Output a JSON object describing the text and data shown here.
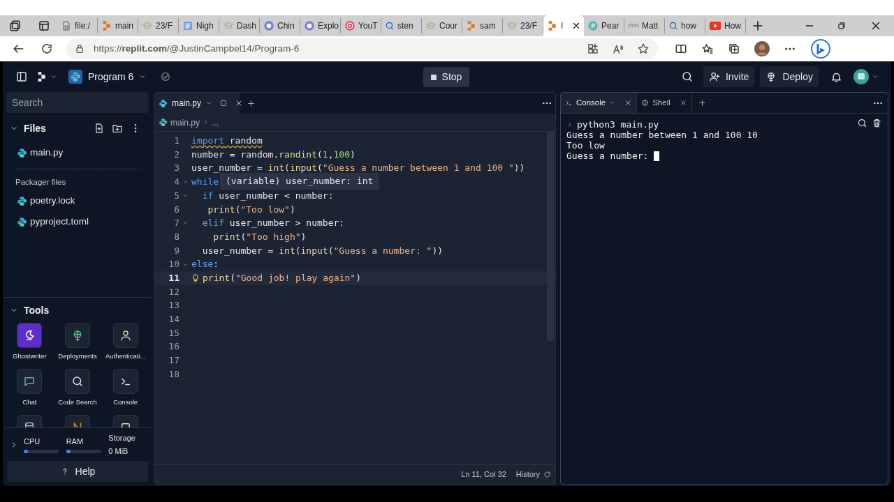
{
  "browser": {
    "tabs": [
      {
        "title": "file:/",
        "kind": "file",
        "selected": false
      },
      {
        "title": "main",
        "kind": "replit",
        "selected": false
      },
      {
        "title": "23/F",
        "kind": "hat",
        "selected": false
      },
      {
        "title": "Nigh",
        "kind": "note",
        "selected": false
      },
      {
        "title": "Dash",
        "kind": "hat",
        "selected": false
      },
      {
        "title": "Chin",
        "kind": "chat",
        "selected": false
      },
      {
        "title": "Explo",
        "kind": "chat",
        "selected": false
      },
      {
        "title": "YouT",
        "kind": "music",
        "selected": false
      },
      {
        "title": "sten",
        "kind": "search",
        "selected": false
      },
      {
        "title": "Cour",
        "kind": "hat",
        "selected": false
      },
      {
        "title": "sam",
        "kind": "replit",
        "selected": false
      },
      {
        "title": "23/F",
        "kind": "hat",
        "selected": false
      },
      {
        "title": "I",
        "kind": "replit",
        "selected": true
      },
      {
        "title": "Pear",
        "kind": "pearson",
        "selected": false
      },
      {
        "title": "Matt",
        "kind": "wave",
        "selected": false
      },
      {
        "title": "how",
        "kind": "search",
        "selected": false
      },
      {
        "title": "How",
        "kind": "youtube",
        "selected": false
      }
    ],
    "url": "https://**replit.com**/@JustinCampbel14/Program-6"
  },
  "topbar": {
    "project": "Program 6",
    "run_button": "Stop",
    "invite": "Invite",
    "deploy": "Deploy"
  },
  "sidebar": {
    "search_placeholder": "Search",
    "files_title": "Files",
    "files": [
      "main.py"
    ],
    "packager_title": "Packager files",
    "packager_files": [
      "poetry.lock",
      "pyproject.toml"
    ],
    "tools_title": "Tools",
    "tools": [
      {
        "label": "Ghostwriter",
        "kind": "ghostwriter",
        "highlighted": true
      },
      {
        "label": "Deployments",
        "kind": "deploy",
        "highlighted": false
      },
      {
        "label": "Authenticati...",
        "kind": "person",
        "highlighted": false
      },
      {
        "label": "Chat",
        "kind": "chat",
        "highlighted": false
      },
      {
        "label": "Code Search",
        "kind": "search",
        "highlighted": false
      },
      {
        "label": "Console",
        "kind": "terminal",
        "highlighted": false
      },
      {
        "kind": "database",
        "highlighted": false
      },
      {
        "kind": "bolt",
        "highlighted": false
      },
      {
        "kind": "square",
        "highlighted": false
      }
    ],
    "resources": [
      {
        "kind": "meter",
        "label": "CPU",
        "level": 0.12
      },
      {
        "kind": "meter",
        "label": "RAM",
        "level": 0.12
      },
      {
        "kind": "reading",
        "label": "Storage",
        "reading": "0 MiB"
      }
    ],
    "help": "Help"
  },
  "editor": {
    "tabs": [
      {
        "label": "main.py",
        "selected": true
      }
    ],
    "breadcrumb": [
      "main.py",
      "..."
    ],
    "lines": [
      {
        "n": "1",
        "fold": false,
        "current": false,
        "hint": false,
        "warning": true,
        "tokens": [
          {
            "kind": "keyword",
            "text": "import"
          },
          {
            "kind": "plain",
            "text": " random"
          }
        ]
      },
      {
        "n": "2",
        "fold": false,
        "current": false,
        "hint": false,
        "warning": false,
        "tokens": [
          {
            "kind": "plain",
            "text": "number = random."
          },
          {
            "kind": "method",
            "text": "randint"
          },
          {
            "kind": "plain",
            "text": "("
          },
          {
            "kind": "number",
            "text": "1"
          },
          {
            "kind": "plain",
            "text": ","
          },
          {
            "kind": "number",
            "text": "100"
          },
          {
            "kind": "plain",
            "text": ")"
          }
        ]
      },
      {
        "n": "3",
        "fold": false,
        "current": false,
        "hint": false,
        "warning": false,
        "tokens": [
          {
            "kind": "plain",
            "text": "user_number = "
          },
          {
            "kind": "function",
            "text": "int"
          },
          {
            "kind": "plain",
            "text": "("
          },
          {
            "kind": "function",
            "text": "input"
          },
          {
            "kind": "plain",
            "text": "("
          },
          {
            "kind": "string",
            "text": "\"Guess a number between 1 and 100 \""
          },
          {
            "kind": "plain",
            "text": "))"
          }
        ]
      },
      {
        "n": "4",
        "fold": true,
        "current": false,
        "hint": false,
        "warning": false,
        "tokens": [
          {
            "kind": "keyword",
            "text": "while"
          }
        ]
      },
      {
        "n": "5",
        "fold": true,
        "current": false,
        "hint": false,
        "warning": false,
        "tokens": [
          {
            "kind": "keyword",
            "text": "  if"
          },
          {
            "kind": "plain",
            "text": " user_number < number:"
          }
        ]
      },
      {
        "n": "6",
        "fold": false,
        "current": false,
        "hint": false,
        "warning": false,
        "tokens": [
          {
            "kind": "function",
            "text": "   print"
          },
          {
            "kind": "plain",
            "text": "("
          },
          {
            "kind": "string",
            "text": "\"Too low\""
          },
          {
            "kind": "plain",
            "text": ")"
          }
        ]
      },
      {
        "n": "7",
        "fold": true,
        "current": false,
        "hint": false,
        "warning": false,
        "tokens": [
          {
            "kind": "keyword",
            "text": "  elif"
          },
          {
            "kind": "plain",
            "text": " user_number > number:"
          }
        ]
      },
      {
        "n": "8",
        "fold": false,
        "current": false,
        "hint": false,
        "warning": false,
        "tokens": [
          {
            "kind": "function",
            "text": "    print"
          },
          {
            "kind": "plain",
            "text": "("
          },
          {
            "kind": "string",
            "text": "\"Too high\""
          },
          {
            "kind": "plain",
            "text": ")"
          }
        ]
      },
      {
        "n": "9",
        "fold": false,
        "current": false,
        "hint": false,
        "warning": false,
        "tokens": [
          {
            "kind": "plain",
            "text": "  user_number = "
          },
          {
            "kind": "function",
            "text": "int"
          },
          {
            "kind": "plain",
            "text": "("
          },
          {
            "kind": "function",
            "text": "input"
          },
          {
            "kind": "plain",
            "text": "("
          },
          {
            "kind": "string",
            "text": "\"Guess a number: \""
          },
          {
            "kind": "plain",
            "text": "))"
          }
        ]
      },
      {
        "n": "10",
        "fold": true,
        "current": false,
        "hint": false,
        "warning": false,
        "tokens": [
          {
            "kind": "keyword",
            "text": "else"
          },
          {
            "kind": "plain",
            "text": ":"
          }
        ]
      },
      {
        "n": "11",
        "fold": false,
        "current": true,
        "hint": true,
        "warning": false,
        "tokens": [
          {
            "kind": "function",
            "text": "print"
          },
          {
            "kind": "plain",
            "text": "("
          },
          {
            "kind": "string",
            "text": "\"Good job! play again\""
          },
          {
            "kind": "plain",
            "text": ")"
          }
        ]
      },
      {
        "n": "12",
        "fold": false,
        "current": false,
        "hint": false
      },
      {
        "n": "13",
        "fold": false,
        "current": false,
        "hint": false
      },
      {
        "n": "14",
        "fold": false,
        "current": false,
        "hint": false
      },
      {
        "n": "15",
        "fold": false,
        "current": false,
        "hint": false
      },
      {
        "n": "16",
        "fold": false,
        "current": false,
        "hint": false
      },
      {
        "n": "17",
        "fold": false,
        "current": false,
        "hint": false
      },
      {
        "n": "18",
        "fold": false,
        "current": false,
        "hint": false
      }
    ],
    "tooltip": "(variable) user_number: int",
    "status": {
      "position": "Ln 11, Col 32",
      "history": "History"
    }
  },
  "console": {
    "tabs": [
      {
        "label": "Console",
        "kind": "terminal",
        "selected": true
      },
      {
        "label": "Shell",
        "kind": "shell",
        "selected": false
      }
    ],
    "output": [
      {
        "kind": "command",
        "text": "python3 main.py"
      },
      {
        "kind": "output",
        "text": "Guess a number between 1 and 100 10"
      },
      {
        "kind": "output",
        "text": "Too low"
      },
      {
        "kind": "input",
        "text": "Guess a number: "
      }
    ]
  }
}
